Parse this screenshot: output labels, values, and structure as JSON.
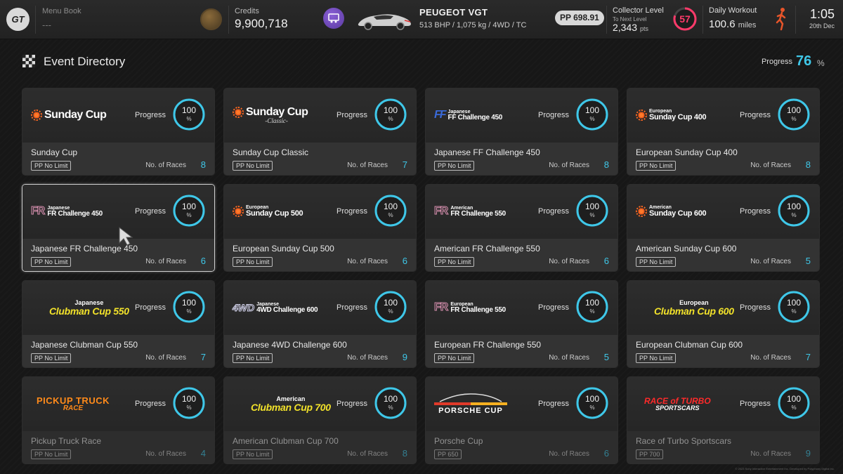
{
  "topbar": {
    "menu_book_label": "Menu Book",
    "menu_book_value": "---",
    "credits_label": "Credits",
    "credits_value": "9,900,718",
    "car_name": "PEUGEOT VGT",
    "car_specs": "513 BHP / 1,075 kg / 4WD / TC",
    "pp_badge": "PP 698.91",
    "collector_label": "Collector Level",
    "collector_sub": "To Next Level",
    "collector_pts": "2,343",
    "collector_pts_unit": "pts",
    "collector_level": "57",
    "collector_progress": 0.8,
    "workout_label": "Daily Workout",
    "workout_value": "100.6",
    "workout_unit": "miles",
    "time": "1:05",
    "date": "20th Dec",
    "colors": {
      "accent": "#3fc7e8",
      "level": "#ff3a6a"
    }
  },
  "header": {
    "title": "Event Directory",
    "progress_label": "Progress",
    "progress_value": "76",
    "progress_unit": "%"
  },
  "labels": {
    "progress": "Progress",
    "percent": "%",
    "races": "No. of Races"
  },
  "cards": [
    {
      "name": "Sunday Cup",
      "pp": "PP No Limit",
      "races": "8",
      "progress": "100",
      "logo": {
        "type": "sunday",
        "text": "Sunday Cup"
      }
    },
    {
      "name": "Sunday Cup Classic",
      "pp": "PP No Limit",
      "races": "7",
      "progress": "100",
      "logo": {
        "type": "sunday-classic",
        "text": "Sunday Cup",
        "sub": "-Classic-"
      }
    },
    {
      "name": "Japanese FF Challenge 450",
      "pp": "PP No Limit",
      "races": "8",
      "progress": "100",
      "logo": {
        "type": "ff",
        "mark": "FF",
        "small": "Japanese",
        "text": "FF Challenge 450"
      }
    },
    {
      "name": "European Sunday Cup 400",
      "pp": "PP No Limit",
      "races": "8",
      "progress": "100",
      "logo": {
        "type": "sunday-region",
        "small": "European",
        "text": "Sunday Cup 400"
      }
    },
    {
      "name": "Japanese FR Challenge 450",
      "pp": "PP No Limit",
      "races": "6",
      "progress": "100",
      "selected": true,
      "logo": {
        "type": "fr",
        "mark": "FR",
        "small": "Japanese",
        "text": "FR Challenge 450"
      }
    },
    {
      "name": "European Sunday Cup 500",
      "pp": "PP No Limit",
      "races": "6",
      "progress": "100",
      "logo": {
        "type": "sunday-region",
        "small": "European",
        "text": "Sunday Cup 500"
      }
    },
    {
      "name": "American FR Challenge 550",
      "pp": "PP No Limit",
      "races": "6",
      "progress": "100",
      "logo": {
        "type": "fr",
        "mark": "FR",
        "small": "American",
        "text": "FR Challenge 550"
      }
    },
    {
      "name": "American Sunday Cup 600",
      "pp": "PP No Limit",
      "races": "5",
      "progress": "100",
      "logo": {
        "type": "sunday-region",
        "small": "American",
        "text": "Sunday Cup 600"
      }
    },
    {
      "name": "Japanese Clubman Cup 550",
      "pp": "PP No Limit",
      "races": "7",
      "progress": "100",
      "logo": {
        "type": "clubman",
        "small": "Japanese",
        "text": "Clubman Cup 550"
      }
    },
    {
      "name": "Japanese 4WD Challenge 600",
      "pp": "PP No Limit",
      "races": "9",
      "progress": "100",
      "logo": {
        "type": "4wd",
        "mark": "4WD",
        "small": "Japanese",
        "text": "4WD Challenge 600"
      }
    },
    {
      "name": "European FR Challenge 550",
      "pp": "PP No Limit",
      "races": "5",
      "progress": "100",
      "logo": {
        "type": "fr",
        "mark": "FR",
        "small": "European",
        "text": "FR Challenge 550"
      }
    },
    {
      "name": "European Clubman Cup 600",
      "pp": "PP No Limit",
      "races": "7",
      "progress": "100",
      "logo": {
        "type": "clubman",
        "small": "European",
        "text": "Clubman Cup 600"
      }
    },
    {
      "name": "Pickup Truck Race",
      "pp": "PP No Limit",
      "races": "4",
      "progress": "100",
      "faded": true,
      "logo": {
        "type": "pickup",
        "text": "PICKUP TRUCK",
        "sub": "RACE"
      }
    },
    {
      "name": "American Clubman Cup 700",
      "pp": "PP No Limit",
      "races": "8",
      "progress": "100",
      "faded": true,
      "logo": {
        "type": "clubman",
        "small": "American",
        "text": "Clubman Cup 700"
      }
    },
    {
      "name": "Porsche Cup",
      "pp": "PP 650",
      "races": "6",
      "progress": "100",
      "faded": true,
      "logo": {
        "type": "porsche",
        "text": "PORSCHE CUP"
      }
    },
    {
      "name": "Race of Turbo Sportscars",
      "pp": "PP 700",
      "races": "9",
      "progress": "100",
      "faded": true,
      "logo": {
        "type": "turbo",
        "text": "RACE of TURBO",
        "sub": "SPORTSCARS"
      }
    }
  ],
  "footer_note": "© 2023 Sony Interactive Entertainment Inc. Developed by Polyphony Digital Inc."
}
